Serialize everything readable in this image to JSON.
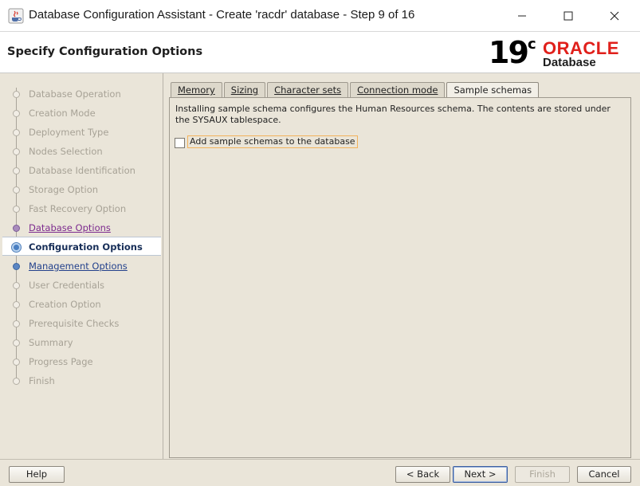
{
  "window": {
    "title": "Database Configuration Assistant - Create 'racdr' database - Step 9 of 16",
    "app_icon": "java-cup-icon",
    "controls": [
      "minimize-icon",
      "maximize-icon",
      "close-icon"
    ]
  },
  "header": {
    "page_title": "Specify Configuration Options",
    "logo_version": "19",
    "logo_version_suffix": "c",
    "logo_brand": "ORACLE",
    "logo_product": "Database"
  },
  "nav": {
    "items": [
      {
        "label": "Database Operation",
        "state": "disabled"
      },
      {
        "label": "Creation Mode",
        "state": "disabled"
      },
      {
        "label": "Deployment Type",
        "state": "disabled"
      },
      {
        "label": "Nodes Selection",
        "state": "disabled"
      },
      {
        "label": "Database Identification",
        "state": "disabled"
      },
      {
        "label": "Storage Option",
        "state": "disabled"
      },
      {
        "label": "Fast Recovery Option",
        "state": "disabled"
      },
      {
        "label": "Database Options",
        "state": "visited"
      },
      {
        "label": "Configuration Options",
        "state": "current"
      },
      {
        "label": "Management Options",
        "state": "link"
      },
      {
        "label": "User Credentials",
        "state": "disabled"
      },
      {
        "label": "Creation Option",
        "state": "disabled"
      },
      {
        "label": "Prerequisite Checks",
        "state": "disabled"
      },
      {
        "label": "Summary",
        "state": "disabled"
      },
      {
        "label": "Progress Page",
        "state": "disabled"
      },
      {
        "label": "Finish",
        "state": "disabled"
      }
    ]
  },
  "tabs": [
    {
      "label": "Memory",
      "active": false
    },
    {
      "label": "Sizing",
      "active": false
    },
    {
      "label": "Character sets",
      "active": false
    },
    {
      "label": "Connection mode",
      "active": false
    },
    {
      "label": "Sample schemas",
      "active": true
    }
  ],
  "content": {
    "description": "Installing sample schema configures the Human Resources schema. The contents are stored under the SYSAUX tablespace.",
    "checkbox_label": "Add sample schemas to the database",
    "checkbox_checked": false
  },
  "footer": {
    "help": "Help",
    "back": "< Back",
    "next": "Next >",
    "finish": "Finish",
    "cancel": "Cancel"
  },
  "colors": {
    "panel_bg": "#eae5d9",
    "oracle_red": "#e0201b",
    "current_step_text": "#172e58",
    "visited_step_text": "#7c2a8e",
    "link_step_text": "#23418c"
  }
}
